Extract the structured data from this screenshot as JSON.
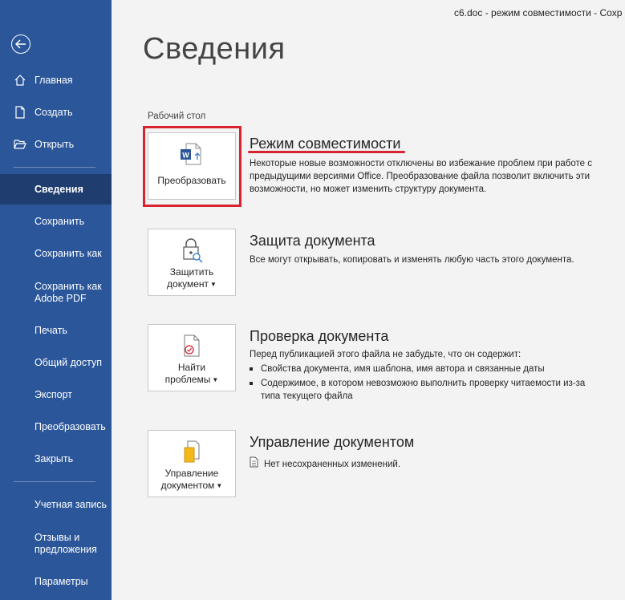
{
  "window": {
    "title": "с6.doc  -  режим совместимости  -  Сохр"
  },
  "sidebar": {
    "items": [
      {
        "label": "Главная",
        "icon": "home-icon"
      },
      {
        "label": "Создать",
        "icon": "new-document-icon"
      },
      {
        "label": "Открыть",
        "icon": "folder-open-icon"
      },
      {
        "label": "Сведения"
      },
      {
        "label": "Сохранить"
      },
      {
        "label": "Сохранить как"
      },
      {
        "label": "Сохранить как Adobe PDF"
      },
      {
        "label": "Печать"
      },
      {
        "label": "Общий доступ"
      },
      {
        "label": "Экспорт"
      },
      {
        "label": "Преобразовать"
      },
      {
        "label": "Закрыть"
      },
      {
        "label": "Учетная запись"
      },
      {
        "label": "Отзывы и предложения"
      },
      {
        "label": "Параметры"
      }
    ],
    "active": "Сведения"
  },
  "main": {
    "page_title": "Сведения",
    "location_caption": "Рабочий стол",
    "sections": [
      {
        "button_label": "Преобразовать",
        "title": "Режим совместимости",
        "text": "Некоторые новые возможности отключены во избежание проблем при работе с предыдущими версиями Office. Преобразование файла позволит включить эти возможности, но может изменить структуру документа."
      },
      {
        "button_label_1": "Защитить",
        "button_label_2": "документ",
        "title": "Защита документа",
        "text": "Все могут открывать, копировать и изменять любую часть этого документа."
      },
      {
        "button_label_1": "Найти",
        "button_label_2": "проблемы",
        "title": "Проверка документа",
        "text": "Перед публикацией этого файла не забудьте, что он содержит:",
        "bullets": [
          "Свойства документа, имя шаблона, имя автора и связанные даты",
          "Содержимое, в котором невозможно выполнить проверку читаемости из-за типа текущего файла"
        ]
      },
      {
        "button_label_1": "Управление",
        "button_label_2": "документом",
        "title": "Управление документом",
        "status": "Нет несохраненных изменений."
      }
    ]
  },
  "colors": {
    "sidebar": "#2b579a",
    "sidebar_active": "#1f3d6e",
    "highlight": "#d9232e",
    "word_blue": "#2b579a"
  }
}
